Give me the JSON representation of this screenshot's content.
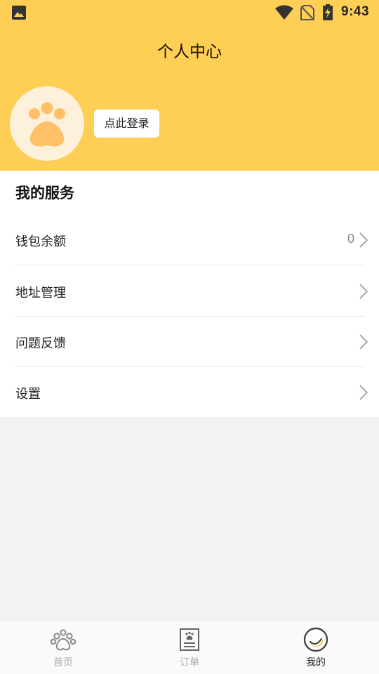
{
  "status_bar": {
    "time": "9:43",
    "icons": [
      "image-notification-icon",
      "wifi-icon",
      "no-sim-icon",
      "battery-charging-icon"
    ]
  },
  "header": {
    "title": "个人中心",
    "login_button": "点此登录",
    "avatar_icon": "paw-icon"
  },
  "services": {
    "title": "我的服务",
    "items": [
      {
        "label": "钱包余额",
        "value": "0"
      },
      {
        "label": "地址管理",
        "value": ""
      },
      {
        "label": "问题反馈",
        "value": ""
      },
      {
        "label": "设置",
        "value": ""
      }
    ]
  },
  "tabbar": {
    "tabs": [
      {
        "label": "首页",
        "icon": "paw-icon",
        "active": false
      },
      {
        "label": "订单",
        "icon": "order-document-icon",
        "active": false
      },
      {
        "label": "我的",
        "icon": "smile-face-icon",
        "active": true
      }
    ]
  },
  "colors": {
    "brand_yellow": "#ffce55",
    "tab_inactive": "#aaaaaa",
    "tab_active": "#222222",
    "background": "#f2f2f2"
  }
}
